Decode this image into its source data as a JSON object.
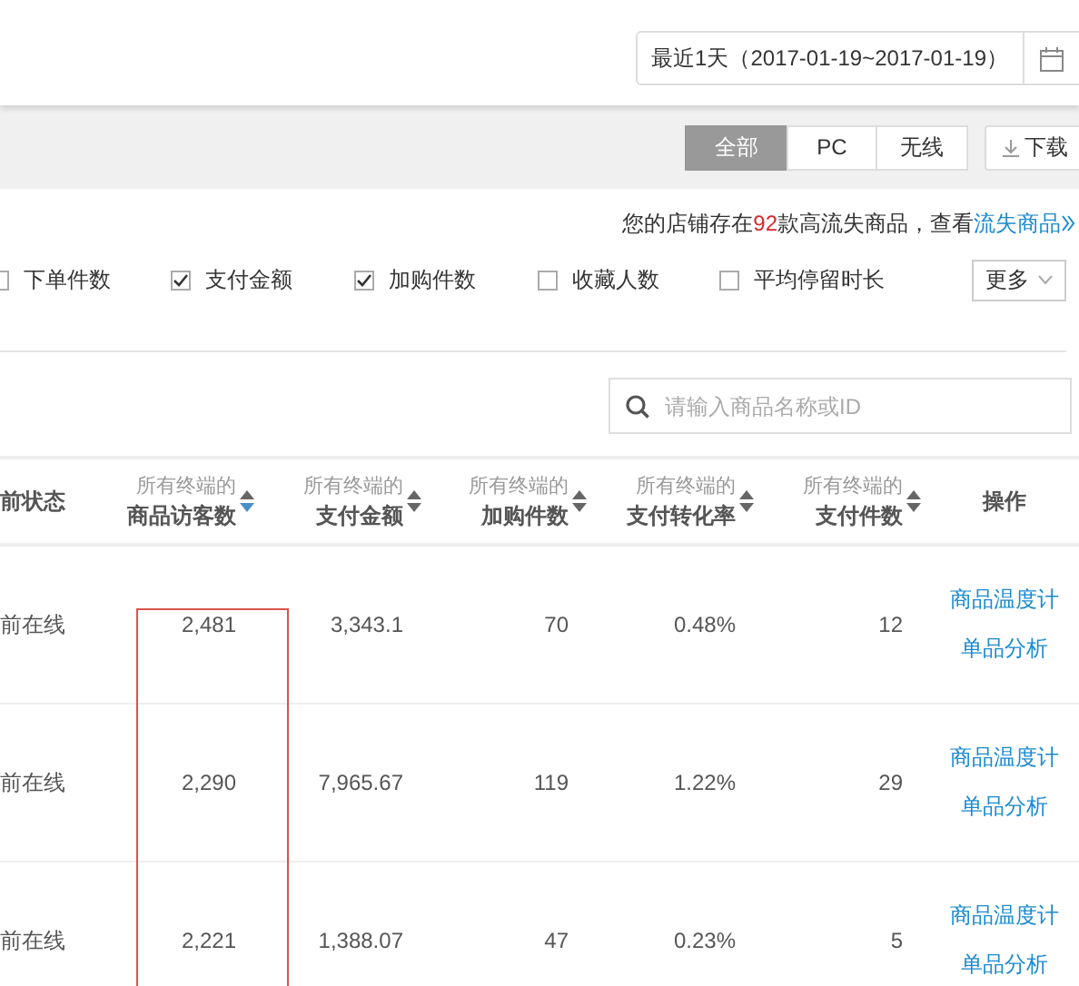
{
  "date_range": {
    "label": "最近1天（2017-01-19~2017-01-19）"
  },
  "terminal_tabs": [
    {
      "label": "全部",
      "selected": true
    },
    {
      "label": "PC",
      "selected": false
    },
    {
      "label": "无线",
      "selected": false
    }
  ],
  "download_button": {
    "label": "下载"
  },
  "notice": {
    "text_before": "您的店铺存在",
    "count": "92",
    "text_after": "款高流失商品，查看",
    "link": "流失商品"
  },
  "metrics": [
    {
      "label": "下单件数",
      "checked": false
    },
    {
      "label": "支付金额",
      "checked": true
    },
    {
      "label": "加购件数",
      "checked": true
    },
    {
      "label": "收藏人数",
      "checked": false
    },
    {
      "label": "平均停留时长",
      "checked": false
    }
  ],
  "more_button": {
    "label": "更多"
  },
  "search": {
    "placeholder": "请输入商品名称或ID"
  },
  "table": {
    "columns": [
      {
        "kind": "text",
        "label": "前状态"
      },
      {
        "kind": "metric",
        "prefix": "所有终端的",
        "label": "商品访客数",
        "sorted": true,
        "highlighted": true
      },
      {
        "kind": "metric",
        "prefix": "所有终端的",
        "label": "支付金额",
        "sorted": false
      },
      {
        "kind": "metric",
        "prefix": "所有终端的",
        "label": "加购件数",
        "sorted": false
      },
      {
        "kind": "metric",
        "prefix": "所有终端的",
        "label": "支付转化率",
        "sorted": false
      },
      {
        "kind": "metric",
        "prefix": "所有终端的",
        "label": "支付件数",
        "sorted": false
      },
      {
        "kind": "actions",
        "label": "操作"
      }
    ],
    "rows": [
      {
        "cells": [
          "前在线",
          "2,481",
          "3,343.1",
          "70",
          "0.48%",
          "12"
        ],
        "actions": [
          "商品温度计",
          "单品分析"
        ]
      },
      {
        "cells": [
          "前在线",
          "2,290",
          "7,965.67",
          "119",
          "1.22%",
          "29"
        ],
        "actions": [
          "商品温度计",
          "单品分析"
        ]
      },
      {
        "cells": [
          "前在线",
          "2,221",
          "1,388.07",
          "47",
          "0.23%",
          "5"
        ],
        "actions": [
          "商品温度计",
          "单品分析"
        ]
      }
    ]
  }
}
